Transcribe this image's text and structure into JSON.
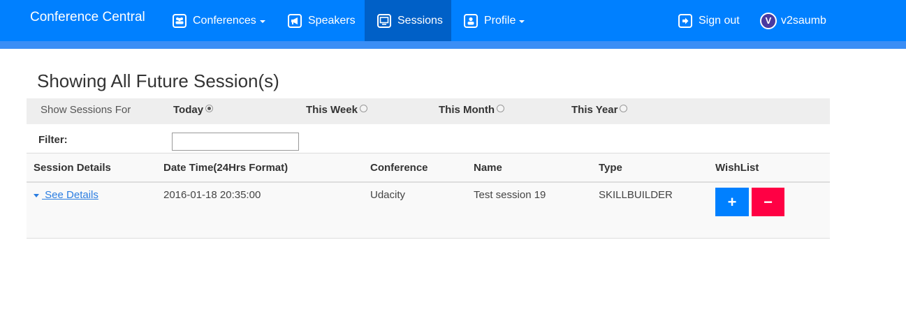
{
  "navbar": {
    "brand": "Conference Central",
    "items": [
      {
        "label": "Conferences",
        "icon": "users-icon",
        "dropdown": true
      },
      {
        "label": "Speakers",
        "icon": "megaphone-icon"
      },
      {
        "label": "Sessions",
        "icon": "monitor-icon",
        "active": true
      },
      {
        "label": "Profile",
        "icon": "user-icon",
        "dropdown": true
      }
    ],
    "sign_out": "Sign out",
    "username": "v2saumb",
    "avatar_letter": "V"
  },
  "page": {
    "title": "Showing All Future Session(s)"
  },
  "filter_bar": {
    "label": "Show Sessions For",
    "options": [
      {
        "label": "Today",
        "checked": true
      },
      {
        "label": "This Week",
        "checked": false
      },
      {
        "label": "This Month",
        "checked": false
      },
      {
        "label": "This Year",
        "checked": false
      }
    ],
    "filter_label": "Filter:",
    "filter_value": ""
  },
  "table": {
    "headers": [
      "Session Details",
      "Date Time(24Hrs Format)",
      "Conference",
      "Name",
      "Type",
      "WishList"
    ],
    "rows": [
      {
        "details_link": " See Details",
        "datetime": "2016-01-18 20:35:00",
        "conference": "Udacity",
        "name": "Test session 19",
        "type": "SKILLBUILDER",
        "add_label": "+",
        "remove_label": "−"
      }
    ]
  },
  "colors": {
    "navbar": "#0080ff",
    "navbar_active": "#0060c7",
    "add_button": "#0080ff",
    "remove_button": "#ff0044"
  }
}
